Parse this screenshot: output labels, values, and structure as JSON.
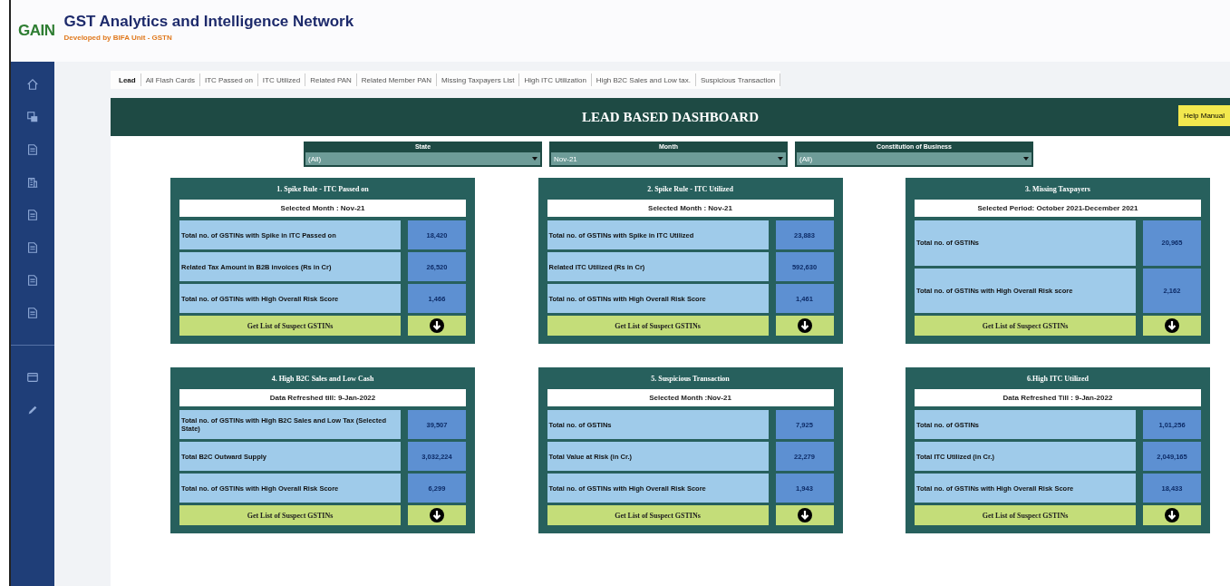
{
  "header": {
    "logo": "GAIN",
    "title": "GST Analytics and Intelligence Network",
    "subtitle": "Developed by BIFA Unit - GSTN"
  },
  "sidebar": {
    "items": [
      {
        "kind": "home"
      },
      {
        "kind": "stack"
      },
      {
        "kind": "doc"
      },
      {
        "kind": "building"
      },
      {
        "kind": "doc"
      },
      {
        "kind": "doc"
      },
      {
        "kind": "doc"
      },
      {
        "kind": "doc"
      },
      {
        "kind": "divider"
      },
      {
        "kind": "card"
      },
      {
        "kind": "pen"
      }
    ]
  },
  "tabs": [
    {
      "label": "Lead",
      "selected": true
    },
    {
      "label": "All Flash Cards",
      "selected": false
    },
    {
      "label": "ITC Passed on",
      "selected": false
    },
    {
      "label": "ITC Utilized",
      "selected": false
    },
    {
      "label": "Related PAN",
      "selected": false
    },
    {
      "label": "Related Member PAN",
      "selected": false
    },
    {
      "label": "Missing Taxpayers List",
      "selected": false
    },
    {
      "label": "High ITC Utilization",
      "selected": false
    },
    {
      "label": "High B2C Sales and Low tax.",
      "selected": false
    },
    {
      "label": "Suspicious Transaction",
      "selected": false
    }
  ],
  "dashboard": {
    "title": "LEAD BASED DASHBOARD",
    "help_button": "Help Manual"
  },
  "filters": [
    {
      "label": "State",
      "value": "(All)"
    },
    {
      "label": "Month",
      "value": "Nov-21"
    },
    {
      "label": "Constitution of Business",
      "value": "(All)"
    }
  ],
  "cards": [
    {
      "title": "1. Spike Rule - ITC Passed on",
      "subtitle": "Selected Month : Nov-21",
      "rows": [
        {
          "label": "Total no. of GSTINs with Spike in ITC Passed on",
          "value": "18,420"
        },
        {
          "label": "Related Tax Amount in B2B invoices (Rs in Cr)",
          "value": "26,520"
        },
        {
          "label": "Total no. of GSTINs with High Overall Risk Score",
          "value": "1,466"
        }
      ],
      "action": "Get List of Suspect GSTINs"
    },
    {
      "title": "2. Spike Rule - ITC Utilized",
      "subtitle": "Selected Month : Nov-21",
      "rows": [
        {
          "label": "Total no. of GSTINs with Spike in ITC Utilized",
          "value": "23,883"
        },
        {
          "label": "Related ITC Utilized (Rs in Cr)",
          "value": "592,630"
        },
        {
          "label": "Total no. of GSTINs with High Overall Risk Score",
          "value": "1,461"
        }
      ],
      "action": "Get List of Suspect GSTINs"
    },
    {
      "title": "3. Missing Taxpayers",
      "subtitle": "Selected Period: October 2021-December 2021",
      "rows": [
        {
          "label": "Total no. of GSTINs",
          "value": "20,965"
        },
        {
          "label": "Total no. of GSTINs with High Overall Risk score",
          "value": "2,162"
        }
      ],
      "action": "Get List of Suspect GSTINs"
    },
    {
      "title": "4. High B2C Sales and Low Cash",
      "subtitle": "Data Refreshed till: 9-Jan-2022",
      "rows": [
        {
          "label": "Total no. of GSTINs with High B2C Sales and Low Tax (Selected State)",
          "value": "39,507"
        },
        {
          "label": "Total B2C Outward Supply",
          "value": "3,032,224"
        },
        {
          "label": "Total no. of GSTINs with High Overall Risk Score",
          "value": "6,299"
        }
      ],
      "action": "Get List of Suspect GSTINs"
    },
    {
      "title": "5. Suspicious Transaction",
      "subtitle": "Selected Month :Nov-21",
      "rows": [
        {
          "label": "Total no. of GSTINs",
          "value": "7,925"
        },
        {
          "label": "Total Value at Risk (in Cr.)",
          "value": "22,279"
        },
        {
          "label": "Total no. of GSTINs with High Overall Risk Score",
          "value": "1,943"
        }
      ],
      "action": "Get List of Suspect GSTINs"
    },
    {
      "title": "6.High ITC Utilized",
      "subtitle": "Data Refreshed Till : 9-Jan-2022",
      "rows": [
        {
          "label": "Total no. of GSTINs",
          "value": "1,01,256"
        },
        {
          "label": "Total ITC Utilized (in Cr.)",
          "value": "2,049,165"
        },
        {
          "label": "Total no. of GSTINs with High Overall Risk Score",
          "value": "18,433"
        }
      ],
      "action": "Get List of Suspect GSTINs"
    }
  ]
}
